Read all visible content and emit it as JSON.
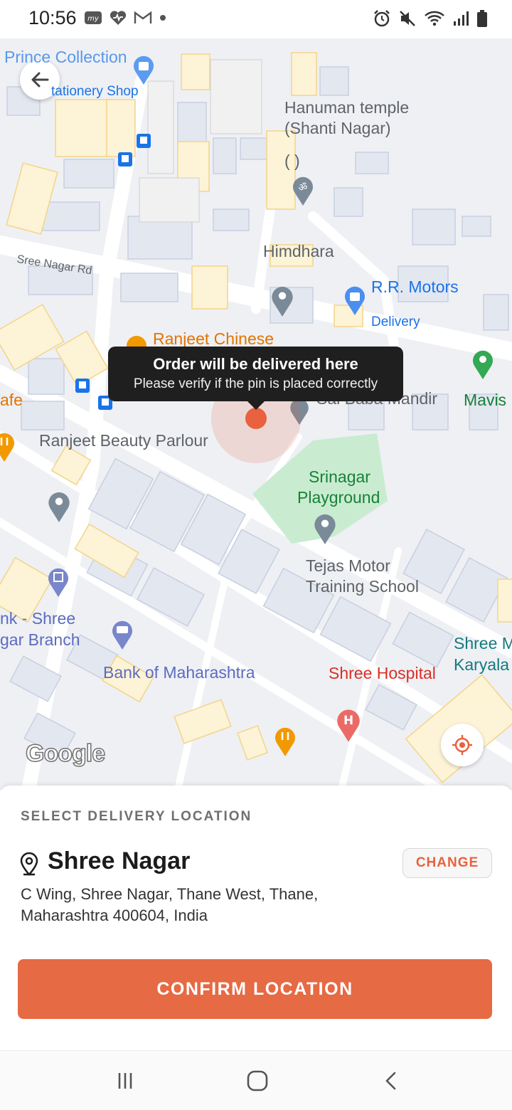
{
  "status_bar": {
    "time": "10:56",
    "left_icons": [
      "myjio-icon",
      "health-heart-icon",
      "gmail-icon",
      "dot-icon"
    ],
    "right_icons": [
      "alarm-icon",
      "mute-icon",
      "wifi-icon",
      "signal-icon",
      "battery-icon"
    ]
  },
  "map": {
    "labels": {
      "prince_collection": "Prince Collection",
      "stationery_shop": "tationery Shop",
      "hanuman_temple_1": "Hanuman temple",
      "hanuman_temple_2": "(Shanti Nagar)",
      "hanuman_temple_3": "(        )",
      "sree_nagar_rd": "Sree Nagar Rd",
      "himdhara": "Himdhara",
      "rr_motors": "R.R. Motors",
      "rr_motors_sub": "Delivery",
      "ranjeet_chinese": "Ranjeet Chinese",
      "cafe": "afe",
      "sai_baba_mandir": "Sai Baba Mandir",
      "mavis": "Mavis",
      "ranjeet_beauty": "Ranjeet Beauty Parlour",
      "srinagar_playground_1": "Srinagar",
      "srinagar_playground_2": "Playground",
      "tejas_motor_1": "Tejas Motor",
      "tejas_motor_2": "Training School",
      "bank_shree_1": "nk - Shree",
      "bank_shree_2": "gar Branch",
      "bank_maharashtra": "Bank of Maharashtra",
      "shree_hospital": "Shree Hospital",
      "shree_karyala_1": "Shree M",
      "shree_karyala_2": "Karyala",
      "google": "Google"
    },
    "tooltip": {
      "title": "Order will be delivered here",
      "subtitle": "Please verify if the pin is placed correctly"
    },
    "colors": {
      "background": "#eef0f4",
      "building": "#e3e7f0",
      "building_yellow": "#fdf3d6",
      "park": "#c9ecd0",
      "pin": "#e8623f"
    }
  },
  "sheet": {
    "heading": "SELECT DELIVERY LOCATION",
    "location_title": "Shree Nagar",
    "change_label": "CHANGE",
    "address": "C Wing, Shree Nagar, Thane West, Thane, Maharashtra 400604, India",
    "confirm_label": "CONFIRM LOCATION",
    "accent_color": "#e66a43"
  },
  "nav_bar": {
    "buttons": [
      "recents-icon",
      "home-icon",
      "back-icon"
    ]
  }
}
